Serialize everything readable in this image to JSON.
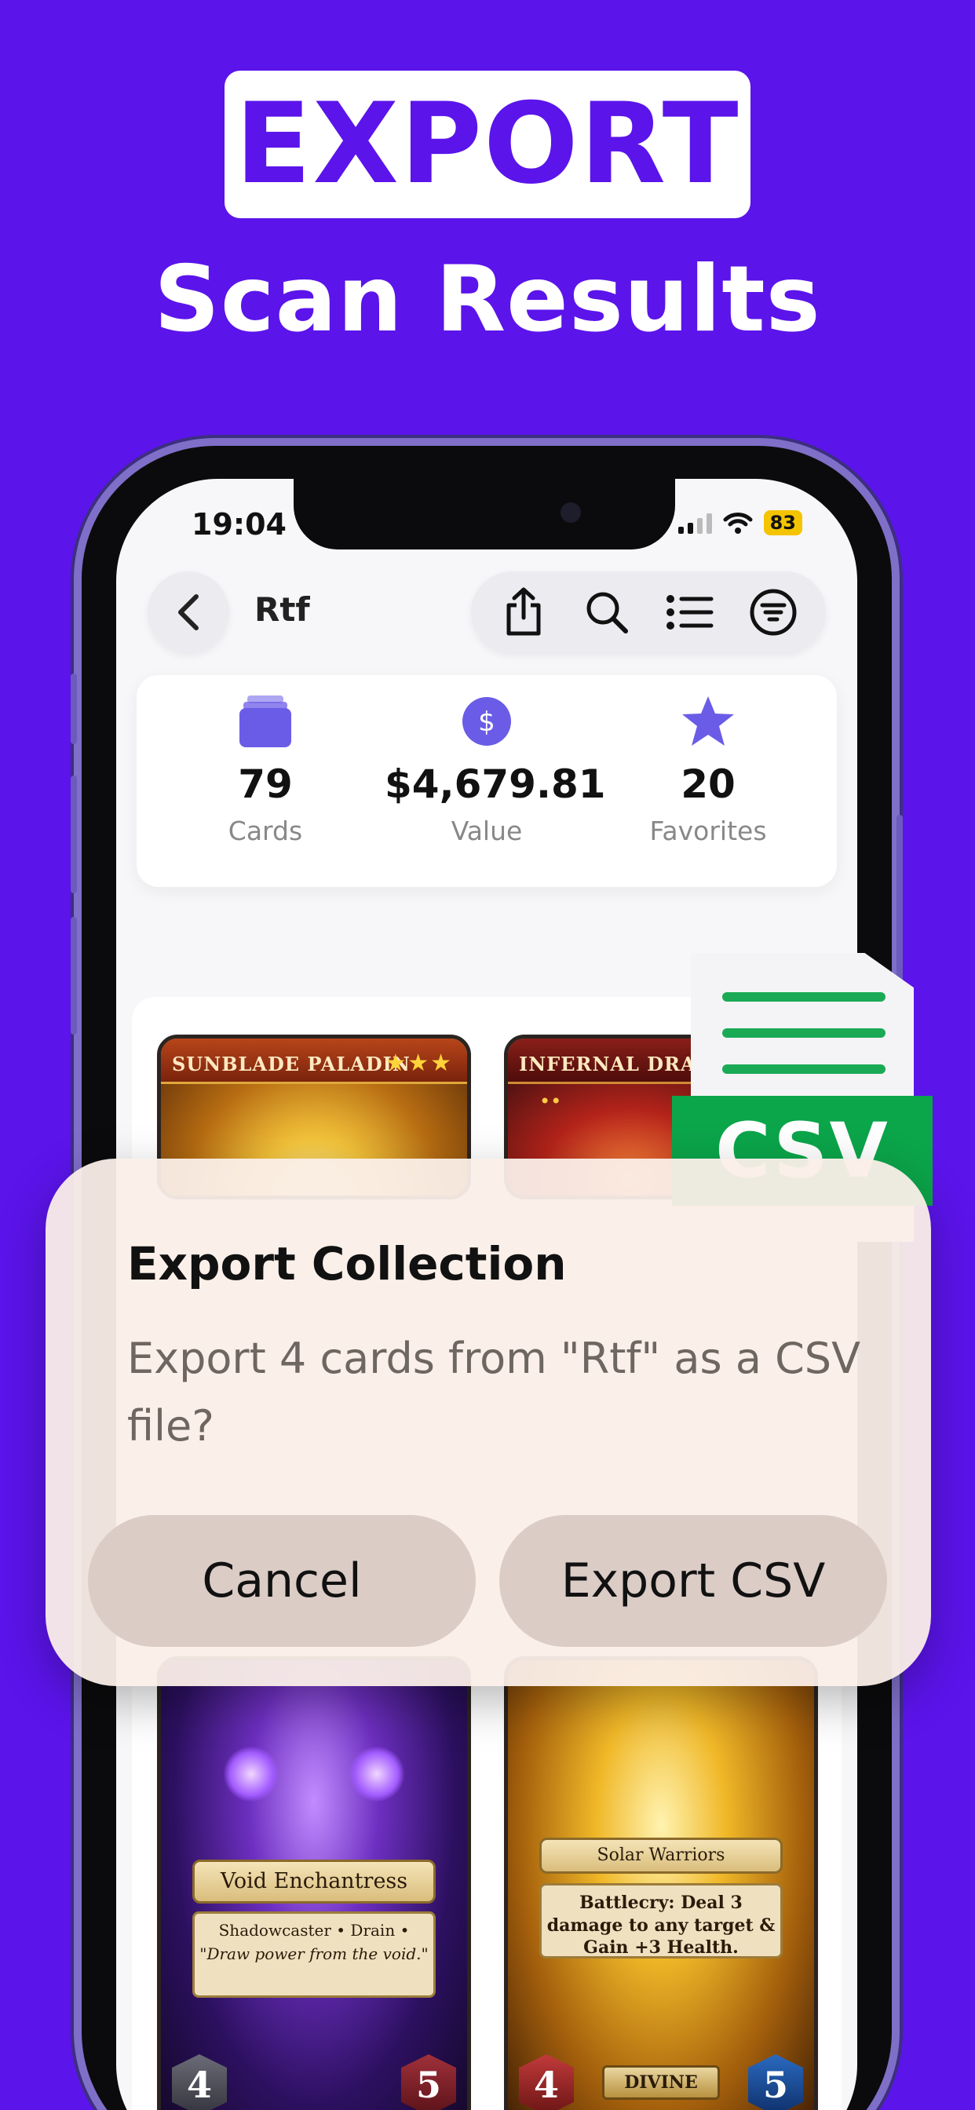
{
  "marketing": {
    "badge": "EXPORT",
    "subhead": "Scan Results"
  },
  "colors": {
    "background": "#5b14ea",
    "accent": "#6b5ce7",
    "csv_green": "#0ba54a"
  },
  "status_bar": {
    "time": "19:04",
    "battery": "83"
  },
  "nav": {
    "title": "Rtf",
    "icons": [
      "back-chevron-icon",
      "share-icon",
      "search-icon",
      "list-icon",
      "filter-icon"
    ]
  },
  "stats": [
    {
      "icon": "cards-stack-icon",
      "value": "79",
      "label": "Cards"
    },
    {
      "icon": "dollar-icon",
      "value": "$4,679.81",
      "label": "Value"
    },
    {
      "icon": "star-icon",
      "value": "20",
      "label": "Favorites"
    }
  ],
  "cards": [
    {
      "name": "SUNBLADE PALADIN",
      "stars": "★★★"
    },
    {
      "name": "INFERNAL DRAGON",
      "stars": "••"
    },
    {
      "name": "Void Enchantress",
      "type_line": "Shadowcaster • Drain •",
      "text": "\"Draw power from the void.\"",
      "attack": "4",
      "health": "5"
    },
    {
      "name": "Solar Warriors",
      "text": "Battlecry: Deal 3 damage to any target & Gain +3 Health.",
      "tag": "DIVINE",
      "attack": "4",
      "health": "5"
    }
  ],
  "csv_icon": {
    "label": "CSV"
  },
  "alert": {
    "title": "Export Collection",
    "message": "Export 4 cards from \"Rtf\" as a CSV file?",
    "cancel_label": "Cancel",
    "confirm_label": "Export CSV"
  }
}
